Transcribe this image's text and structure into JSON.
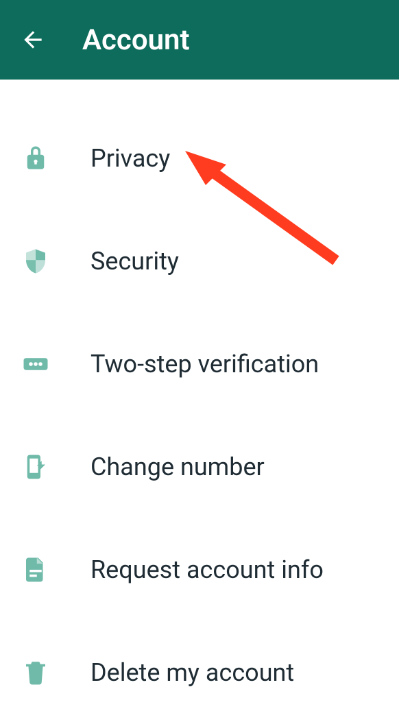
{
  "header": {
    "title": "Account"
  },
  "items": [
    {
      "label": "Privacy",
      "icon": "lock-icon"
    },
    {
      "label": "Security",
      "icon": "shield-icon"
    },
    {
      "label": "Two-step verification",
      "icon": "dots-icon"
    },
    {
      "label": "Change number",
      "icon": "change-number-icon"
    },
    {
      "label": "Request account info",
      "icon": "document-icon"
    },
    {
      "label": "Delete my account",
      "icon": "trash-icon"
    }
  ],
  "colors": {
    "accent": "#6fbaa9",
    "header": "#0d6c5b",
    "arrow": "#ff3c1f"
  },
  "annotation": {
    "type": "arrow",
    "target": "privacy"
  }
}
